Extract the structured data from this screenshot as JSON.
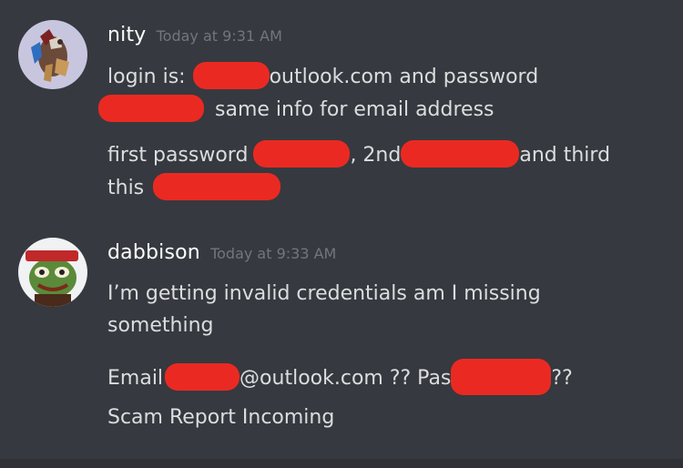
{
  "messages": [
    {
      "username": "nity",
      "timestamp": "Today at 9:31 AM",
      "avatar_icon": "anime-character-avatar",
      "lines": [
        {
          "a": "login is:",
          "b": "outlook.com and password"
        },
        {
          "b": "same info for email address"
        },
        {
          "a": "first password",
          "b": ", 2nd",
          "c": "and third"
        },
        {
          "a": "this"
        }
      ]
    },
    {
      "username": "dabbison",
      "timestamp": "Today at 9:33 AM",
      "avatar_icon": "frog-avatar",
      "lines": [
        {
          "a": "I’m getting invalid credentials am I missing"
        },
        {
          "a": "something"
        },
        {
          "a": "Email",
          "b": "@outlook.com ?? Pas",
          "c": "??"
        },
        {
          "a": "Scam Report Incoming"
        }
      ]
    }
  ],
  "colors": {
    "background": "#36393f",
    "username": "#ffffff",
    "timestamp": "#72767d",
    "message_text": "#dcddde",
    "redaction": "#ea2a22"
  }
}
